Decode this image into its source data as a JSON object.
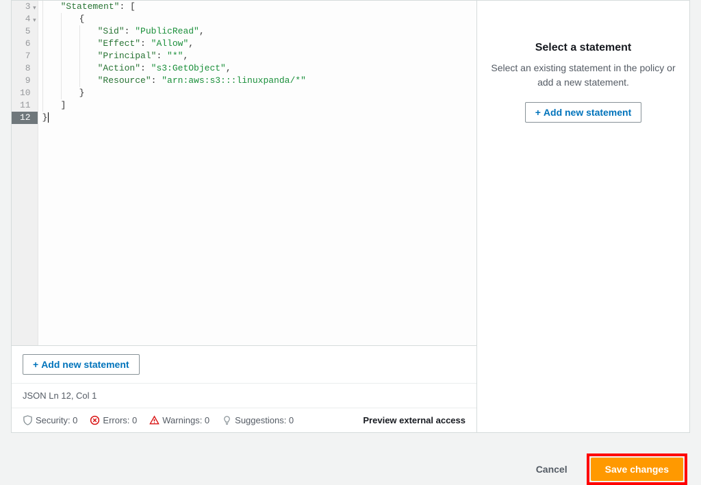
{
  "editor": {
    "lines": [
      {
        "n": 3,
        "fold": true,
        "indent": 1,
        "tokens": [
          [
            "key",
            "\"Statement\""
          ],
          [
            "punc",
            ": ["
          ]
        ]
      },
      {
        "n": 4,
        "fold": true,
        "indent": 2,
        "tokens": [
          [
            "punc",
            "{"
          ]
        ]
      },
      {
        "n": 5,
        "fold": false,
        "indent": 3,
        "tokens": [
          [
            "key",
            "\"Sid\""
          ],
          [
            "punc",
            ": "
          ],
          [
            "str",
            "\"PublicRead\""
          ],
          [
            "punc",
            ","
          ]
        ]
      },
      {
        "n": 6,
        "fold": false,
        "indent": 3,
        "tokens": [
          [
            "key",
            "\"Effect\""
          ],
          [
            "punc",
            ": "
          ],
          [
            "str",
            "\"Allow\""
          ],
          [
            "punc",
            ","
          ]
        ]
      },
      {
        "n": 7,
        "fold": false,
        "indent": 3,
        "tokens": [
          [
            "key",
            "\"Principal\""
          ],
          [
            "punc",
            ": "
          ],
          [
            "str",
            "\"*\""
          ],
          [
            "punc",
            ","
          ]
        ]
      },
      {
        "n": 8,
        "fold": false,
        "indent": 3,
        "tokens": [
          [
            "key",
            "\"Action\""
          ],
          [
            "punc",
            ": "
          ],
          [
            "str",
            "\"s3:GetObject\""
          ],
          [
            "punc",
            ","
          ]
        ]
      },
      {
        "n": 9,
        "fold": false,
        "indent": 3,
        "tokens": [
          [
            "key",
            "\"Resource\""
          ],
          [
            "punc",
            ": "
          ],
          [
            "str",
            "\"arn:aws:s3:::linuxpanda/*\""
          ]
        ]
      },
      {
        "n": 10,
        "fold": false,
        "indent": 2,
        "tokens": [
          [
            "punc",
            "}"
          ]
        ]
      },
      {
        "n": 11,
        "fold": false,
        "indent": 1,
        "tokens": [
          [
            "punc",
            "]"
          ]
        ]
      },
      {
        "n": 12,
        "fold": false,
        "indent": 0,
        "active": true,
        "tokens": [
          [
            "punc",
            "}"
          ]
        ]
      }
    ],
    "add_button": "Add new statement",
    "status": "JSON   Ln 12, Col 1"
  },
  "lint": {
    "security": "Security: 0",
    "errors": "Errors: 0",
    "warnings": "Warnings: 0",
    "suggestions": "Suggestions: 0",
    "preview": "Preview external access"
  },
  "side": {
    "title": "Select a statement",
    "desc": "Select an existing statement in the policy or add a new statement.",
    "add_button": "Add new statement"
  },
  "footer": {
    "cancel": "Cancel",
    "save": "Save changes"
  }
}
